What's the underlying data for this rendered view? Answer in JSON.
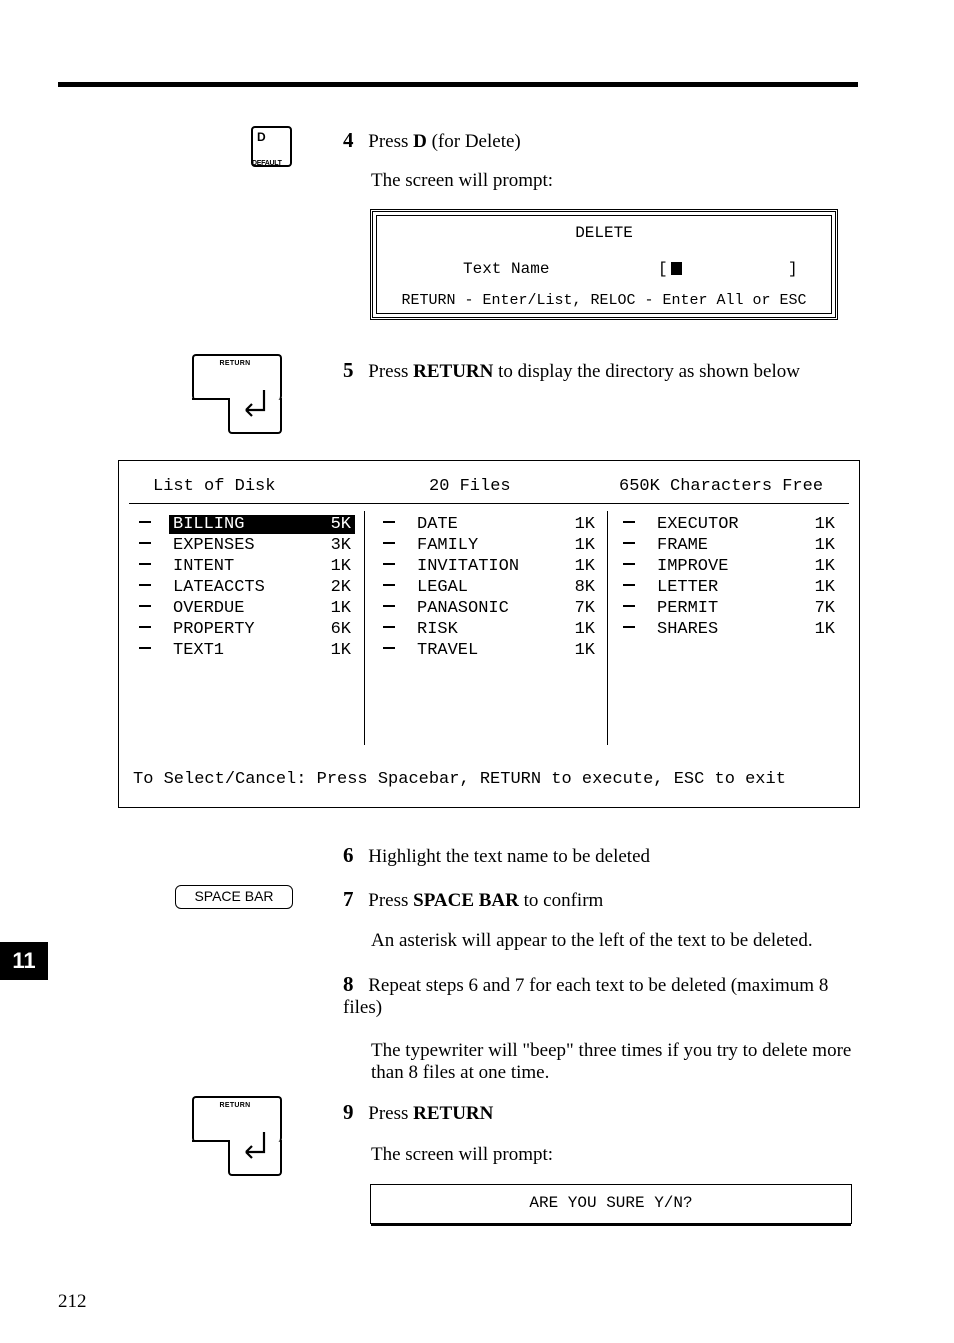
{
  "page_number": "212",
  "side_tab": "11",
  "keycap_d": {
    "letter": "D",
    "label": "DEFAULT"
  },
  "return_key_label": "RETURN",
  "spacebar_label": "SPACE BAR",
  "steps": {
    "s4": {
      "num": "4",
      "pre": "Press ",
      "key": "D",
      "post": " (for Delete)"
    },
    "s4_note": "The screen will prompt:",
    "s5": {
      "num": "5",
      "pre": "Press ",
      "key": "RETURN",
      "post": " to display the directory as shown below"
    },
    "s6": {
      "num": "6",
      "text": "Highlight the text name to be deleted"
    },
    "s7": {
      "num": "7",
      "pre": "Press ",
      "key": "SPACE BAR",
      "post": " to confirm"
    },
    "s7_note": "An asterisk will appear to the left of the text to be deleted.",
    "s8": {
      "num": "8",
      "text": "Repeat steps 6 and 7 for each text to be deleted (maximum 8 files)"
    },
    "s8_note": "The typewriter will \"beep\" three times if you try to delete more than 8 files at one time.",
    "s9": {
      "num": "9",
      "pre": "Press ",
      "key": "RETURN"
    },
    "s9_note": "The screen will prompt:"
  },
  "delete_prompt": {
    "title": "DELETE",
    "field_label": "Text Name",
    "bracket_l": "[",
    "bracket_r": "]",
    "hint": "RETURN - Enter/List, RELOC - Enter All or ESC"
  },
  "directory": {
    "header_left": "List of Disk",
    "header_mid": "20 Files",
    "header_right": "650K Characters Free",
    "footer": "To Select/Cancel:  Press Spacebar,  RETURN to execute, ESC to exit",
    "col1": [
      {
        "name": "BILLING",
        "size": "5K",
        "selected": true
      },
      {
        "name": "EXPENSES",
        "size": "3K"
      },
      {
        "name": "INTENT",
        "size": "1K"
      },
      {
        "name": "LATEACCTS",
        "size": "2K"
      },
      {
        "name": "OVERDUE",
        "size": "1K"
      },
      {
        "name": "PROPERTY",
        "size": "6K"
      },
      {
        "name": "TEXT1",
        "size": "1K"
      }
    ],
    "col2": [
      {
        "name": "DATE",
        "size": "1K"
      },
      {
        "name": "FAMILY",
        "size": "1K"
      },
      {
        "name": "INVITATION",
        "size": "1K"
      },
      {
        "name": "LEGAL",
        "size": "8K"
      },
      {
        "name": "PANASONIC",
        "size": "7K"
      },
      {
        "name": "RISK",
        "size": "1K"
      },
      {
        "name": "TRAVEL",
        "size": "1K"
      }
    ],
    "col3": [
      {
        "name": "EXECUTOR",
        "size": "1K"
      },
      {
        "name": "FRAME",
        "size": "1K"
      },
      {
        "name": "IMPROVE",
        "size": "1K"
      },
      {
        "name": "LETTER",
        "size": "1K"
      },
      {
        "name": "PERMIT",
        "size": "7K"
      },
      {
        "name": "SHARES",
        "size": "1K"
      }
    ]
  },
  "sure_prompt": "ARE YOU SURE Y/N?"
}
